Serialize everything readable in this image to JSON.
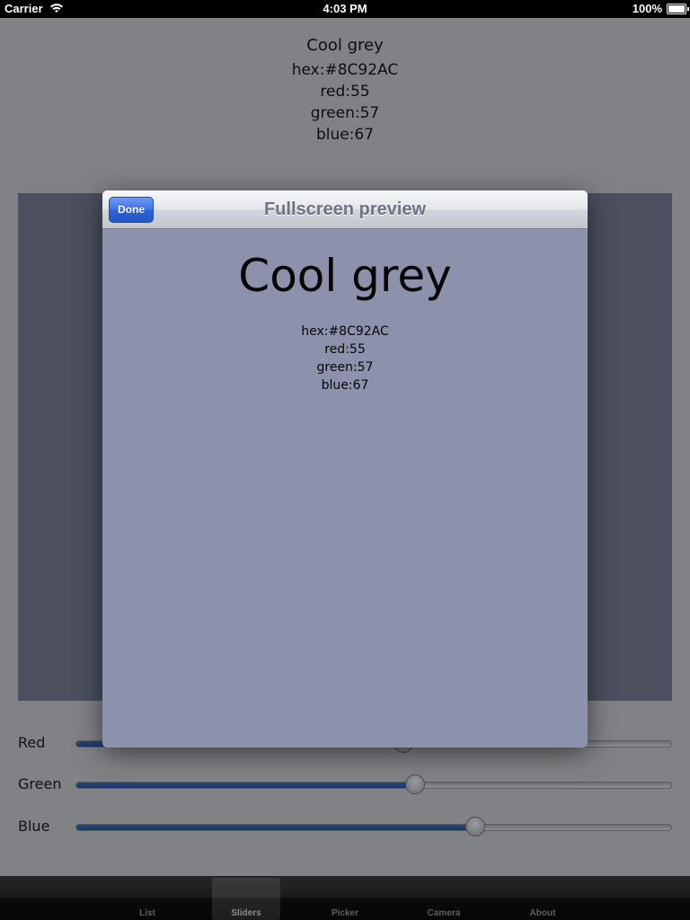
{
  "status_bar": {
    "carrier": "Carrier",
    "time": "4:03 PM",
    "battery": "100%"
  },
  "color": {
    "name": "Cool grey",
    "hex": "hex:#8C92AC",
    "red": "red:55",
    "green": "green:57",
    "blue": "blue:67",
    "swatch_hex": "#8C92AC"
  },
  "sliders": [
    {
      "label": "Red",
      "value": 0.55
    },
    {
      "label": "Green",
      "value": 0.57
    },
    {
      "label": "Blue",
      "value": 0.67
    }
  ],
  "modal": {
    "done_label": "Done",
    "title": "Fullscreen preview",
    "preview_name": "Cool grey",
    "preview_hex": "hex:#8C92AC",
    "preview_red": "red:55",
    "preview_green": "green:57",
    "preview_blue": "blue:67"
  },
  "tabs": [
    {
      "label": "List",
      "icon": "list-icon",
      "selected": false
    },
    {
      "label": "Sliders",
      "icon": "sliders-icon",
      "selected": true
    },
    {
      "label": "Picker",
      "icon": "picker-icon",
      "selected": false
    },
    {
      "label": "Camera",
      "icon": "camera-icon",
      "selected": false
    },
    {
      "label": "About",
      "icon": "about-icon",
      "selected": false
    }
  ]
}
